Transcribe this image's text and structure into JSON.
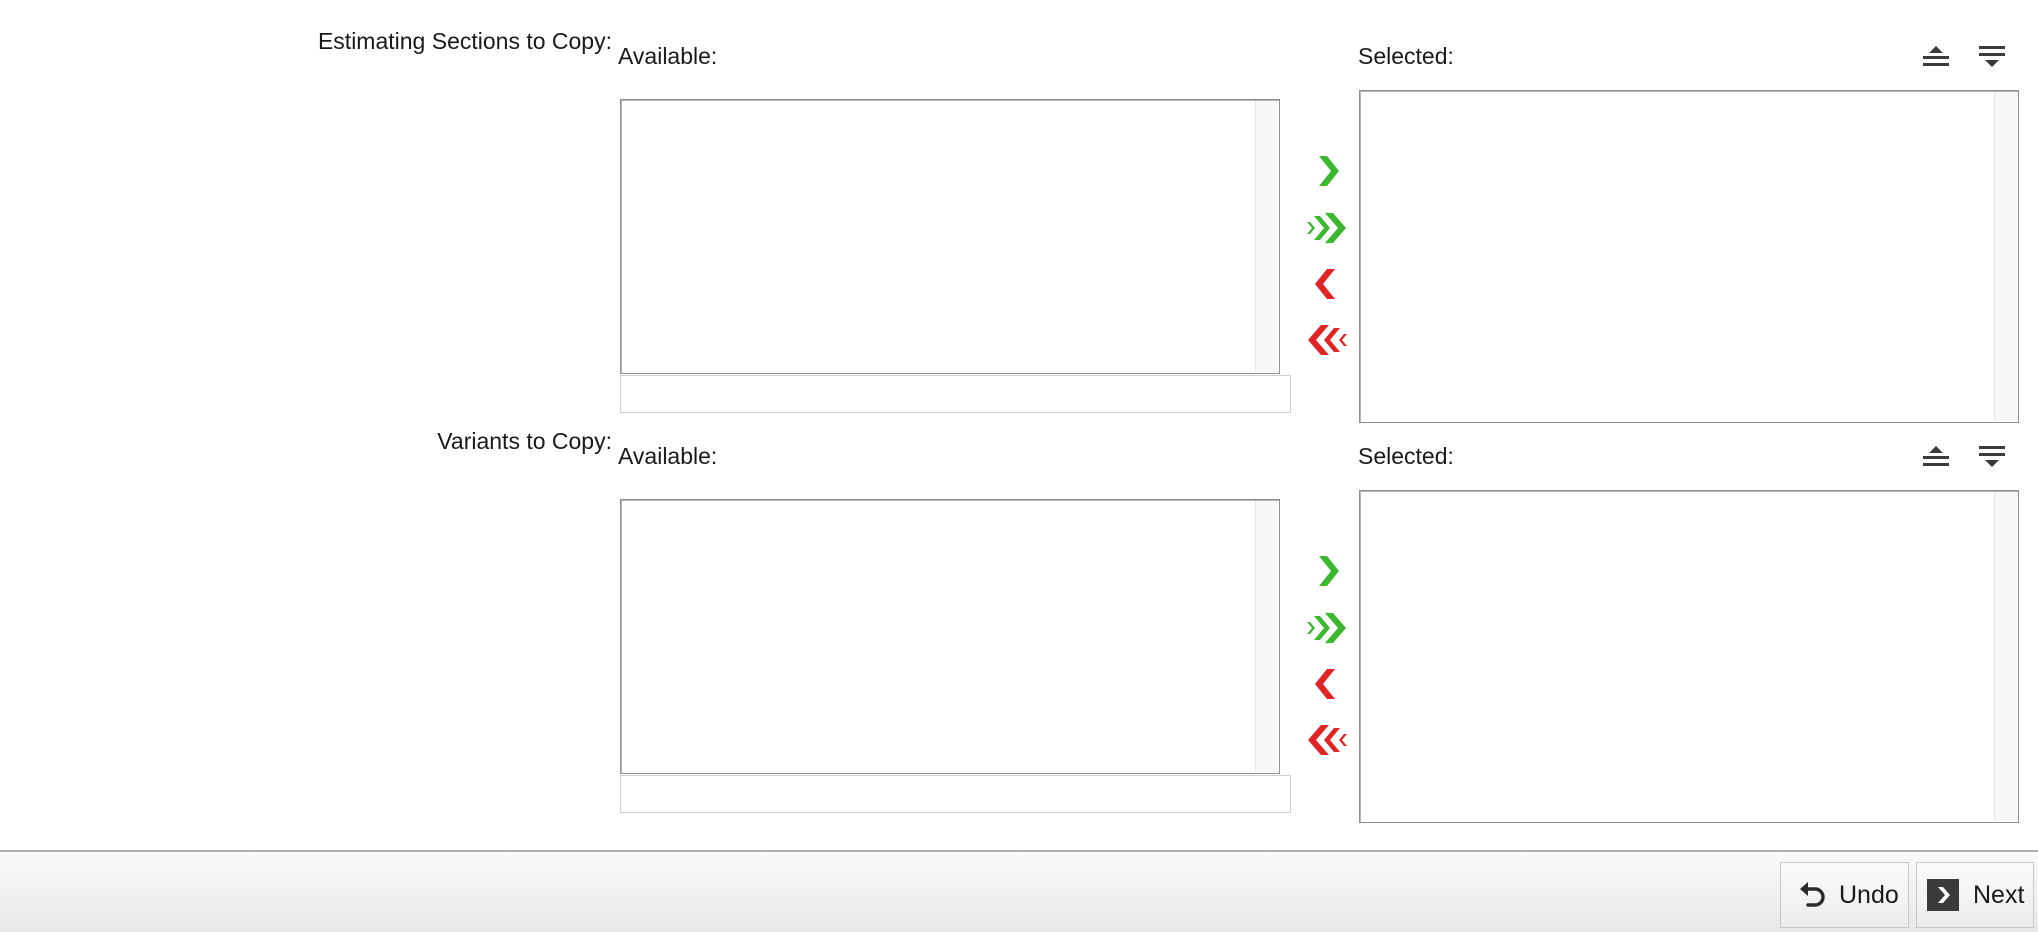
{
  "sections": [
    {
      "label": "Estimating Sections to Copy:",
      "available_label": "Available:",
      "selected_label": "Selected:",
      "available_items": [],
      "selected_items": [],
      "filter_value": ""
    },
    {
      "label": "Variants to Copy:",
      "available_label": "Available:",
      "selected_label": "Selected:",
      "available_items": [],
      "selected_items": [],
      "filter_value": ""
    }
  ],
  "transfer_icons": [
    "move-right-icon",
    "move-all-right-icon",
    "move-left-icon",
    "move-all-left-icon"
  ],
  "sort_icons": [
    "move-to-top-icon",
    "move-to-bottom-icon"
  ],
  "footer": {
    "undo_label": "Undo",
    "next_label": "Next"
  },
  "colors": {
    "add_arrow": "#3cb82e",
    "remove_arrow": "#e02424",
    "sort_icon": "#3a3a3a"
  }
}
